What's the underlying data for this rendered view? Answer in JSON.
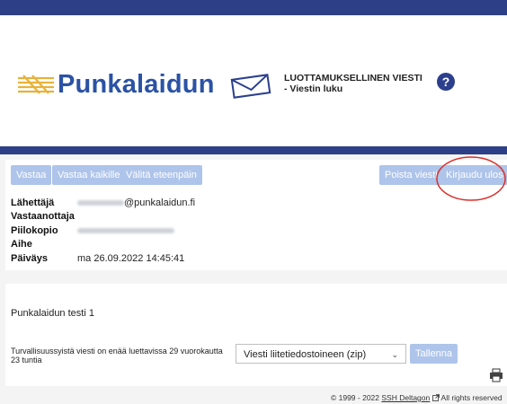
{
  "header": {
    "logo_text": "Punkalaidun",
    "confidential_line1": "LUOTTAMUKSELLINEN VIESTI",
    "confidential_line2": "- Viestin luku",
    "help_symbol": "?"
  },
  "toolbar": {
    "reply": "Vastaa",
    "reply_all": "Vastaa kaikille",
    "forward": "Välitä eteenpäin",
    "delete": "Poista viesti",
    "logout": "Kirjaudu ulos"
  },
  "message": {
    "sender_label": "Lähettäjä",
    "sender_domain": "@punkalaidun.fi",
    "recipient_label": "Vastaanottaja",
    "bcc_label": "Piilokopio",
    "subject_label": "Aihe",
    "date_label": "Päiväys",
    "date_value": "ma 26.09.2022 14:45:41",
    "body_text": "Punkalaidun testi 1"
  },
  "retention_notice": "Turvallisuussyistä viesti on enää luettavissa 29 vuorokautta 23 tuntia",
  "download": {
    "select_value": "Viesti liitetiedostoineen (zip)",
    "save_label": "Tallenna"
  },
  "footer": {
    "copyright": "© 1999 - 2022",
    "vendor_link": "SSH Deltagon",
    "rights": "All rights reserved"
  },
  "colors": {
    "brand_blue": "#2d3f87",
    "button_blue": "#aec4ea",
    "logo_blue": "#2b52a5",
    "logo_gold": "#e8b23a",
    "annotation_red": "#d9302c"
  },
  "icons": [
    "logo-mark-icon",
    "envelope-icon",
    "help-icon",
    "chevron-down-icon",
    "external-link-icon",
    "printer-icon"
  ]
}
